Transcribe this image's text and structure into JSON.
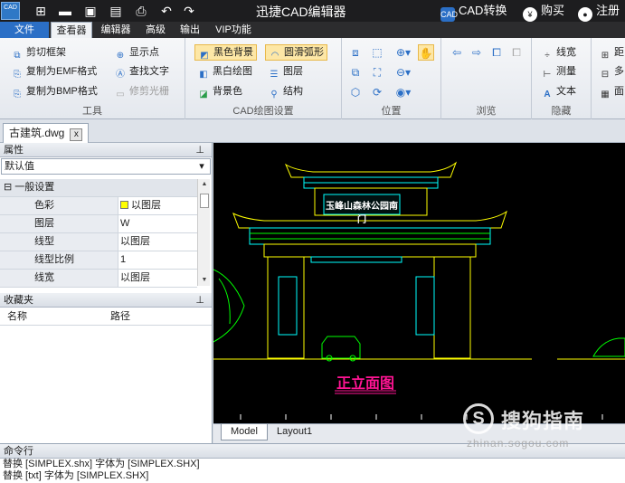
{
  "titlebar": {
    "app_icon_label": "CAD",
    "title": "迅捷CAD编辑器",
    "right": [
      {
        "icon": "cad-convert-icon",
        "badge": "CAD",
        "label": "CAD转换"
      },
      {
        "icon": "yen-icon",
        "badge": "¥",
        "label": "购买"
      },
      {
        "icon": "user-icon",
        "badge": "●",
        "label": "注册"
      }
    ]
  },
  "menu": {
    "file": "文件",
    "tabs": [
      "查看器",
      "编辑器",
      "高级",
      "输出",
      "VIP功能"
    ],
    "active": "查看器"
  },
  "ribbon": {
    "tools": {
      "label": "工具",
      "items": [
        {
          "label": "剪切框架",
          "icon": "crop-icon",
          "enabled": true
        },
        {
          "label": "复制为EMF格式",
          "icon": "copy-emf-icon",
          "enabled": true
        },
        {
          "label": "复制为BMP格式",
          "icon": "copy-bmp-icon",
          "enabled": true
        },
        {
          "label": "显示点",
          "icon": "show-points-icon",
          "enabled": true
        },
        {
          "label": "查找文字",
          "icon": "find-text-icon",
          "enabled": true
        },
        {
          "label": "修剪光栅",
          "icon": "trim-raster-icon",
          "enabled": false
        }
      ]
    },
    "cad_settings": {
      "label": "CAD绘图设置",
      "items": [
        {
          "label": "黑色背景",
          "icon": "black-bg-icon",
          "highlighted": true
        },
        {
          "label": "黑白绘图",
          "icon": "bw-drawing-icon",
          "highlighted": false
        },
        {
          "label": "背景色",
          "icon": "bg-color-icon",
          "highlighted": false
        },
        {
          "label": "圆滑弧形",
          "icon": "smooth-arc-icon",
          "highlighted": true
        },
        {
          "label": "图层",
          "icon": "layers-icon",
          "highlighted": false
        },
        {
          "label": "结构",
          "icon": "structure-icon",
          "highlighted": false
        }
      ]
    },
    "position": {
      "label": "位置"
    },
    "browse": {
      "label": "浏览"
    },
    "hide": {
      "label": "隐藏",
      "items": [
        {
          "label": "线宽",
          "icon": "lineweight-icon"
        },
        {
          "label": "测量",
          "icon": "measure-icon"
        },
        {
          "label": "文本",
          "icon": "text-icon"
        }
      ]
    },
    "extra": {
      "items": [
        {
          "label": "距"
        },
        {
          "label": "多"
        },
        {
          "label": "面"
        }
      ]
    }
  },
  "document": {
    "tab_name": "古建筑.dwg",
    "close_label": "x"
  },
  "properties": {
    "header": "属性",
    "dropdown_value": "默认值",
    "section": "一般设置",
    "rows": [
      {
        "key": "色彩",
        "value": "以图层",
        "swatch": "#ffff00"
      },
      {
        "key": "图层",
        "value": "W"
      },
      {
        "key": "线型",
        "value": "以图层"
      },
      {
        "key": "线型比例",
        "value": "1"
      },
      {
        "key": "线宽",
        "value": "以图层"
      }
    ]
  },
  "favorites": {
    "header": "收藏夹",
    "col_name": "名称",
    "col_path": "路径"
  },
  "drawing": {
    "sign_text": "玉峰山森林公园南门",
    "caption": "正立面图",
    "colors": {
      "roof": "#ffff00",
      "accent": "#00ffff",
      "green": "#00ff00",
      "magenta": "#ff00ff",
      "caption": "#ff1493"
    }
  },
  "layouts": {
    "tabs": [
      "Model",
      "Layout1"
    ],
    "active": "Model"
  },
  "command": {
    "header": "命令行",
    "lines": [
      "替换 [SIMPLEX.shx] 字体为 [SIMPLEX.SHX]",
      "替换 [txt] 字体为 [SIMPLEX.SHX]"
    ]
  },
  "watermark": {
    "logo": "S",
    "text": "搜狗指南",
    "url": "zhinan.sogou.com"
  }
}
